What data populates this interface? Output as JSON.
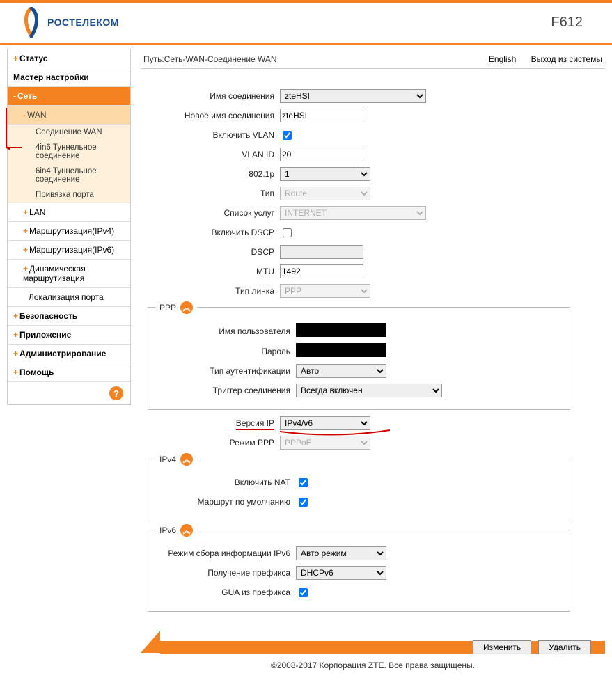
{
  "brand": {
    "company": "РОСТЕЛЕКОМ",
    "model": "F612"
  },
  "topline": {
    "breadcrumb": "Путь:Сеть-WAN-Соединение WAN",
    "english": "English",
    "logout": "Выход из системы"
  },
  "sidebar": {
    "status": "Статус",
    "wizard": "Мастер настройки",
    "network": "Сеть",
    "wan": "WAN",
    "wan_children": [
      "Соединение WAN",
      "4in6 Туннельное соединение",
      "6in4 Туннельное соединение",
      "Привязка порта"
    ],
    "lan": "LAN",
    "routing4": "Маршрутизация(IPv4)",
    "routing6": "Маршрутизация(IPv6)",
    "dynrouting": "Динамическая маршрутизация",
    "portloc": "Локализация порта",
    "security": "Безопасность",
    "application": "Приложение",
    "admin": "Администрирование",
    "help": "Помощь",
    "help_icon": "?"
  },
  "form": {
    "conn_name_label": "Имя соединения",
    "conn_name_value": "zteHSI",
    "new_conn_label": "Новое имя соединения",
    "new_conn_value": "zteHSI",
    "vlan_enable_label": "Включить VLAN",
    "vlan_enable_checked": true,
    "vlan_id_label": "VLAN ID",
    "vlan_id_value": "20",
    "p8021_label": "802.1p",
    "p8021_value": "1",
    "type_label": "Тип",
    "type_value": "Route",
    "services_label": "Список услуг",
    "services_value": "INTERNET",
    "dscp_enable_label": "Включить DSCP",
    "dscp_enable_checked": false,
    "dscp_label": "DSCP",
    "dscp_value": "",
    "mtu_label": "MTU",
    "mtu_value": "1492",
    "link_type_label": "Тип линка",
    "link_type_value": "PPP",
    "ip_version_label": "Версия IP",
    "ip_version_value": "IPv4/v6",
    "ppp_mode_label": "Режим PPP",
    "ppp_mode_value": "PPPoE"
  },
  "ppp": {
    "legend": "PPP",
    "collapse": "︽",
    "user_label": "Имя пользователя",
    "pass_label": "Пароль",
    "auth_label": "Тип аутентификации",
    "auth_value": "Авто",
    "trigger_label": "Триггер соединения",
    "trigger_value": "Всегда включен"
  },
  "ipv4": {
    "legend": "IPv4",
    "collapse": "︽",
    "nat_label": "Включить NAT",
    "nat_checked": true,
    "defroute_label": "Маршрут по умолчанию",
    "defroute_checked": true
  },
  "ipv6": {
    "legend": "IPv6",
    "collapse": "︽",
    "mode_label": "Режим сбора информации IPv6",
    "mode_value": "Авто режим",
    "prefix_label": "Получение префикса",
    "prefix_value": "DHCPv6",
    "gua_label": "GUA из префикса",
    "gua_checked": true
  },
  "buttons": {
    "modify": "Изменить",
    "delete": "Удалить"
  },
  "copyright": "©2008-2017 Корпорация ZTE. Все права защищены."
}
